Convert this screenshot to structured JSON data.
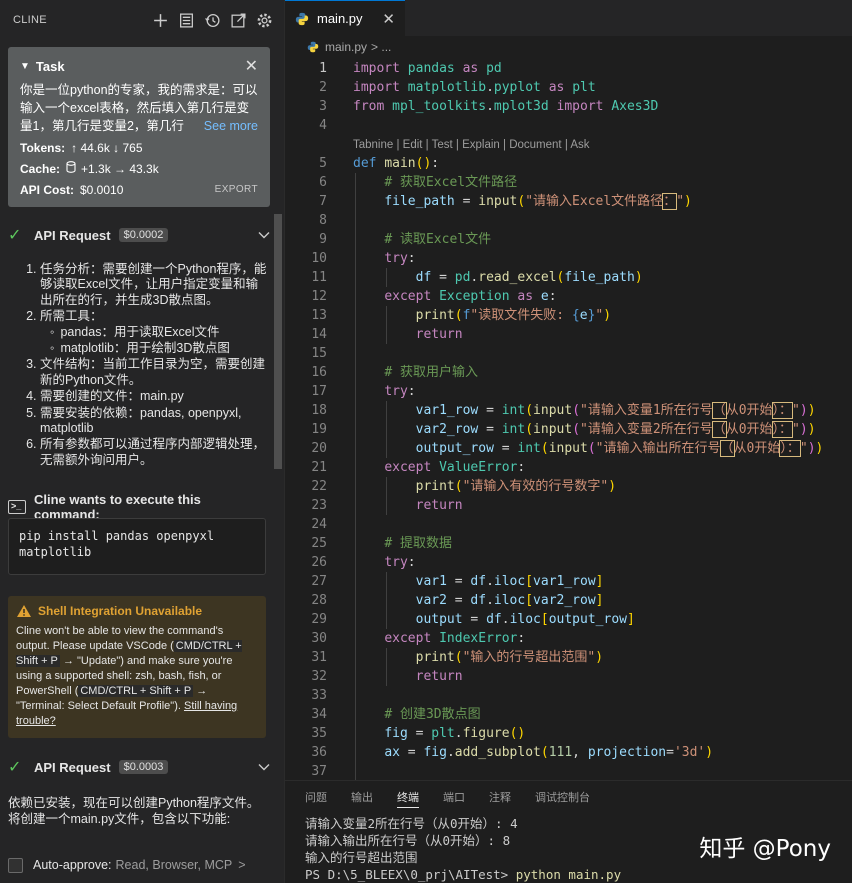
{
  "cline": {
    "title": "CLINE",
    "header_icons": [
      "plus-icon",
      "history-list-icon",
      "history-clock-icon",
      "popout-icon",
      "gear-icon"
    ]
  },
  "task": {
    "label": "Task",
    "text": "你是一位python的专家，我的需求是：可以输入一个excel表格，然后填入第几行是变量1，第几行是变量2，第几行",
    "see_more": "See more",
    "tokens_label": "Tokens:",
    "tokens_value": "↑ 44.6k ↓ 765",
    "cache_label": "Cache:",
    "cache_value": "+1.3k → 43.3k",
    "cost_label": "API Cost:",
    "cost_value": "$0.0010",
    "export": "EXPORT"
  },
  "api1": {
    "label": "API Request",
    "cost": "$0.0002"
  },
  "plan": {
    "items": [
      "任务分析：需要创建一个Python程序，能够读取Excel文件，让用户指定变量和输出所在的行，并生成3D散点图。",
      "所需工具：",
      "文件结构：当前工作目录为空，需要创建新的Python文件。",
      "需要创建的文件：main.py",
      "需要安装的依赖：pandas, openpyxl, matplotlib",
      "所有参数都可以通过程序内部逻辑处理，无需额外询问用户。"
    ],
    "sub_items": [
      "pandas：用于读取Excel文件",
      "matplotlib：用于绘制3D散点图"
    ]
  },
  "exec": {
    "title": "Cline wants to execute this command:",
    "command": "pip install pandas openpyxl matplotlib"
  },
  "warning": {
    "title": "Shell Integration Unavailable",
    "p1": "Cline won't be able to view the command's output. Please update VSCode (",
    "k1": "CMD/CTRL + Shift + P",
    "p2": " → \"Update\") and make sure you're using a supported shell: zsh, bash, fish, or PowerShell (",
    "k2": "CMD/CTRL + Shift + P",
    "p3": " → \"Terminal: Select Default Profile\"). ",
    "link": "Still having trouble?"
  },
  "api2": {
    "label": "API Request",
    "cost": "$0.0003"
  },
  "result_text": "依赖已安装，现在可以创建Python程序文件。将创建一个main.py文件，包含以下功能:",
  "auto_approve": {
    "label": "Auto-approve:",
    "sub": "Read, Browser, MCP",
    "chevron": ">"
  },
  "editor": {
    "tab": "main.py",
    "breadcrumb": "main.py",
    "breadcrumb_sep": "> ...",
    "codelens": "Tabnine | Edit | Test | Explain | Document | Ask"
  },
  "panel": {
    "tabs": [
      "问题",
      "输出",
      "终端",
      "端口",
      "注释",
      "调试控制台"
    ],
    "active_tab": "终端",
    "lines": [
      "请输入变量2所在行号（从0开始）: 4",
      "请输入输出所在行号（从0开始）: 8",
      "输入的行号超出范围"
    ],
    "prompt": "PS D:\\5_BLEEX\\0_prj\\AITest>",
    "prompt_cmd": "python main.py",
    "watermark": "知乎 @Pony"
  },
  "colors": {
    "accent": "#0078d4",
    "success": "#5dc75d",
    "warning": "#e0a233",
    "link": "#75beff"
  }
}
